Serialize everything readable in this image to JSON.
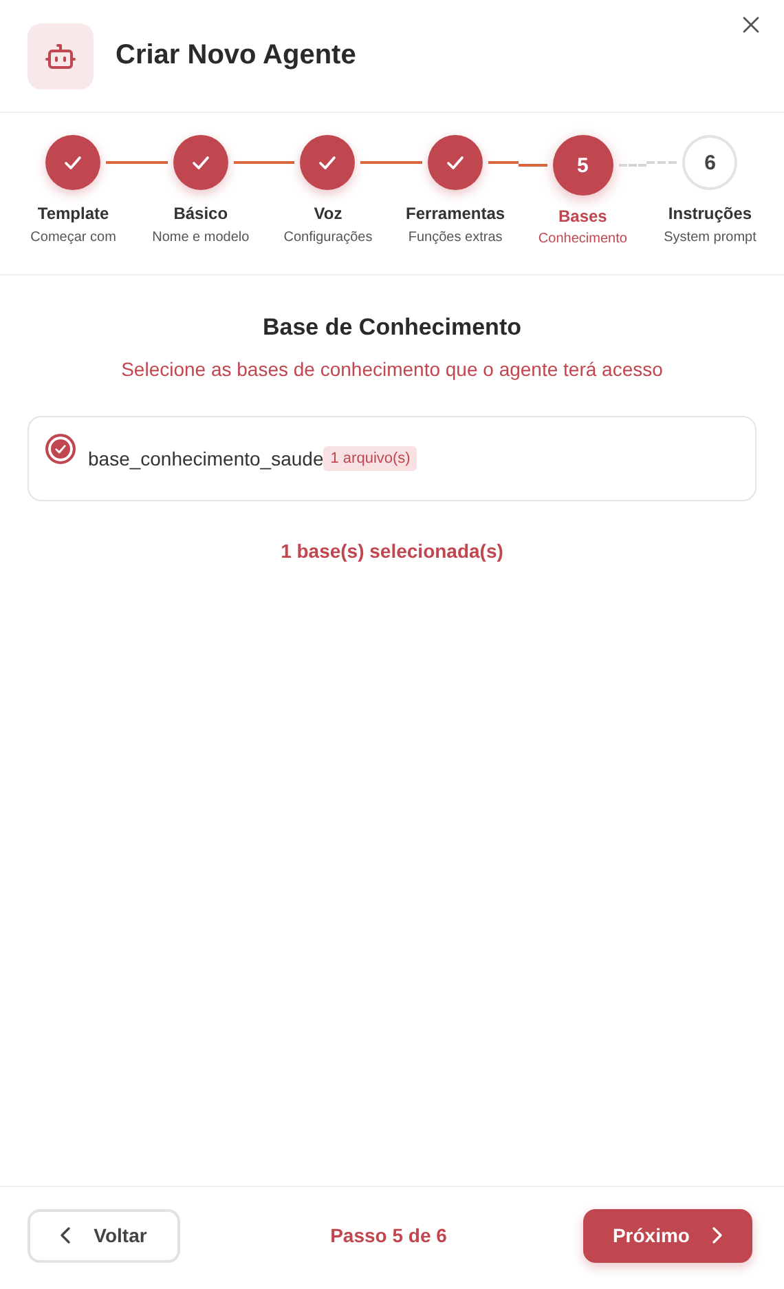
{
  "dialog": {
    "title": "Criar Novo Agente"
  },
  "steps": [
    {
      "label": "Template",
      "sublabel": "Começar com",
      "kind": "done"
    },
    {
      "label": "Básico",
      "sublabel": "Nome e modelo",
      "kind": "done"
    },
    {
      "label": "Voz",
      "sublabel": "Configurações",
      "kind": "done"
    },
    {
      "label": "Ferramentas",
      "sublabel": "Funções extras",
      "kind": "done"
    },
    {
      "number": "5",
      "label": "Bases",
      "sublabel": "Conhecimento",
      "kind": "current"
    },
    {
      "number": "6",
      "label": "Instruções",
      "sublabel": "System prompt",
      "kind": "pending"
    }
  ],
  "section": {
    "title": "Base de Conhecimento",
    "subtitle": "Selecione as bases de conhecimento que o agente terá acesso"
  },
  "bases": [
    {
      "name": "base_conhecimento_saude",
      "badge": "1 arquivo(s)",
      "selected": true
    }
  ],
  "selection_summary": "1 base(s) selecionada(s)",
  "footer": {
    "back": "Voltar",
    "progress": "Passo 5 de 6",
    "next": "Próximo"
  }
}
